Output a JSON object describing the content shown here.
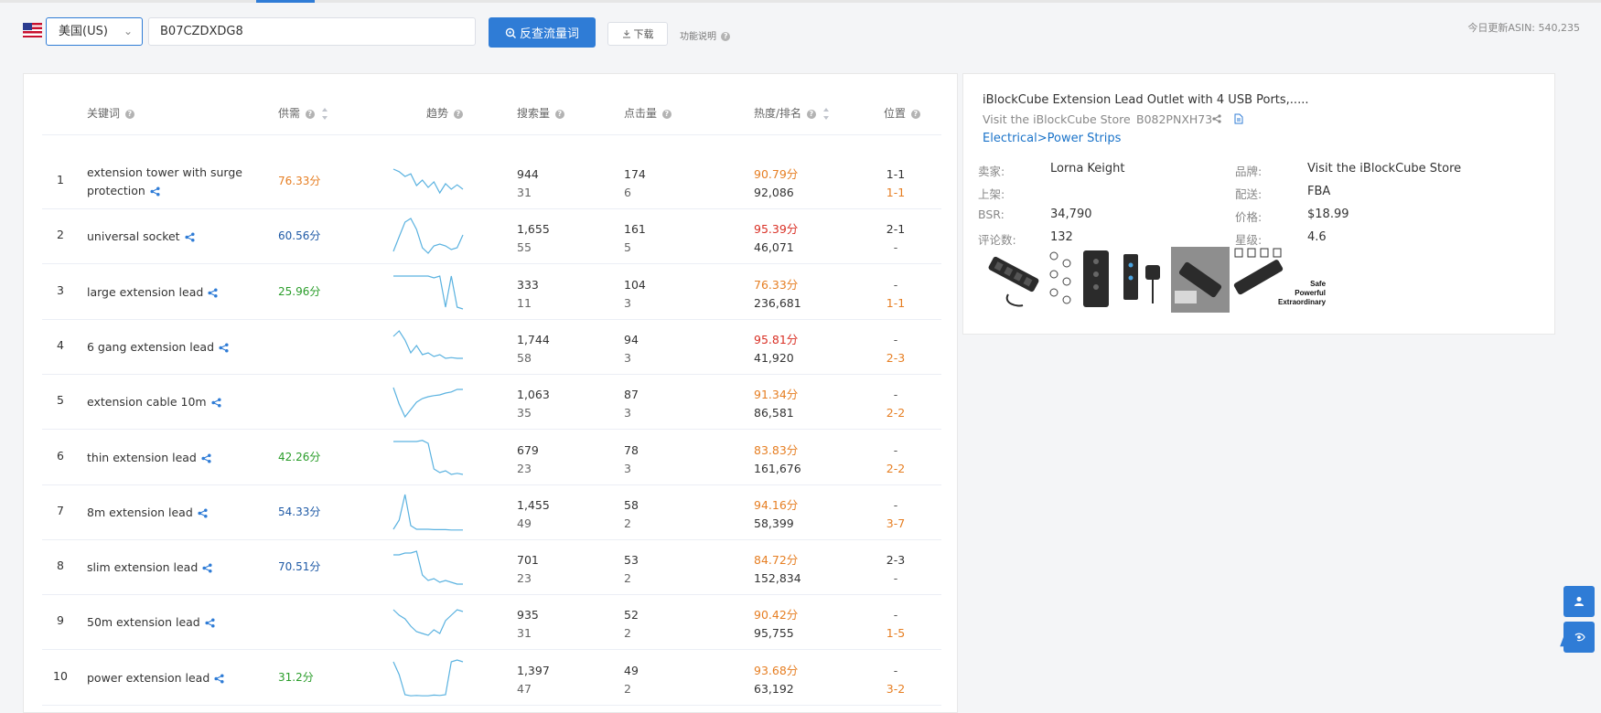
{
  "toolbar": {
    "marketplace": "美国(US)",
    "asin": "B07CZDXDG8",
    "reverse_button": "反查流量词",
    "download_button": "下载",
    "help_label": "功能说明",
    "update_info": "今日更新ASIN: 540,235"
  },
  "columns": {
    "keyword": "关键词",
    "supply": "供需",
    "trend": "趋势",
    "search_volume": "搜索量",
    "clicks": "点击量",
    "heat_rank": "热度/排名",
    "position": "位置"
  },
  "rows": [
    {
      "idx": "1",
      "keyword": "extension tower with surge protection",
      "supply": "76.33分",
      "supply_color": "#e67e22",
      "search": "944",
      "search_sub": "31",
      "clicks": "174",
      "clicks_sub": "6",
      "heat": "90.79分",
      "heat_color": "#e67e22",
      "rank": "92,086",
      "pos1": "1-1",
      "pos2": "1-1",
      "trend": [
        0.85,
        0.78,
        0.65,
        0.72,
        0.4,
        0.55,
        0.35,
        0.5,
        0.2,
        0.45,
        0.3,
        0.42,
        0.3
      ]
    },
    {
      "idx": "2",
      "keyword": "universal socket",
      "supply": "60.56分",
      "supply_color": "#1f5aa6",
      "search": "1,655",
      "search_sub": "55",
      "clicks": "161",
      "clicks_sub": "5",
      "heat": "95.39分",
      "heat_color": "#d93025",
      "rank": "46,071",
      "pos1": "2-1",
      "pos2": "-",
      "trend": [
        0.1,
        0.5,
        0.9,
        1.0,
        0.7,
        0.2,
        0.05,
        0.25,
        0.3,
        0.25,
        0.15,
        0.2,
        0.55
      ]
    },
    {
      "idx": "3",
      "keyword": "large extension lead",
      "supply": "25.96分",
      "supply_color": "#2a9d2a",
      "search": "333",
      "search_sub": "11",
      "clicks": "104",
      "clicks_sub": "3",
      "heat": "76.33分",
      "heat_color": "#e67e22",
      "rank": "236,681",
      "pos1": "-",
      "pos2": "1-1",
      "trend": [
        0.95,
        0.95,
        0.95,
        0.95,
        0.95,
        0.95,
        0.95,
        0.9,
        0.95,
        0.1,
        0.95,
        0.1,
        0.05
      ]
    },
    {
      "idx": "4",
      "keyword": "6 gang extension lead",
      "supply": "",
      "supply_color": "#333333",
      "search": "1,744",
      "search_sub": "58",
      "clicks": "94",
      "clicks_sub": "3",
      "heat": "95.81分",
      "heat_color": "#d93025",
      "rank": "41,920",
      "pos1": "-",
      "pos2": "2-3",
      "trend": [
        0.8,
        0.95,
        0.7,
        0.35,
        0.55,
        0.3,
        0.35,
        0.25,
        0.3,
        0.2,
        0.22,
        0.2,
        0.2
      ]
    },
    {
      "idx": "5",
      "keyword": "extension cable 10m",
      "supply": "",
      "supply_color": "#333333",
      "search": "1,063",
      "search_sub": "35",
      "clicks": "87",
      "clicks_sub": "3",
      "heat": "91.34分",
      "heat_color": "#e67e22",
      "rank": "86,581",
      "pos1": "-",
      "pos2": "2-2",
      "trend": [
        0.9,
        0.45,
        0.1,
        0.3,
        0.5,
        0.6,
        0.65,
        0.68,
        0.7,
        0.75,
        0.78,
        0.85,
        0.85
      ]
    },
    {
      "idx": "6",
      "keyword": "thin extension lead",
      "supply": "42.26分",
      "supply_color": "#2a9d2a",
      "search": "679",
      "search_sub": "23",
      "clicks": "78",
      "clicks_sub": "3",
      "heat": "83.83分",
      "heat_color": "#e67e22",
      "rank": "161,676",
      "pos1": "-",
      "pos2": "2-2",
      "trend": [
        0.95,
        0.95,
        0.95,
        0.95,
        0.95,
        0.98,
        0.9,
        0.2,
        0.1,
        0.15,
        0.05,
        0.08,
        0.05
      ]
    },
    {
      "idx": "7",
      "keyword": "8m extension lead",
      "supply": "54.33分",
      "supply_color": "#1f5aa6",
      "search": "1,455",
      "search_sub": "49",
      "clicks": "58",
      "clicks_sub": "2",
      "heat": "94.16分",
      "heat_color": "#e67e22",
      "rank": "58,399",
      "pos1": "-",
      "pos2": "3-7",
      "trend": [
        0.05,
        0.3,
        1.0,
        0.15,
        0.05,
        0.05,
        0.05,
        0.04,
        0.04,
        0.04,
        0.03,
        0.03,
        0.03
      ]
    },
    {
      "idx": "8",
      "keyword": "slim extension lead",
      "supply": "70.51分",
      "supply_color": "#1f5aa6",
      "search": "701",
      "search_sub": "23",
      "clicks": "53",
      "clicks_sub": "2",
      "heat": "84.72分",
      "heat_color": "#e67e22",
      "rank": "152,834",
      "pos1": "2-3",
      "pos2": "-",
      "trend": [
        0.85,
        0.85,
        0.9,
        0.9,
        0.95,
        0.3,
        0.15,
        0.2,
        0.1,
        0.15,
        0.1,
        0.05,
        0.05
      ]
    },
    {
      "idx": "9",
      "keyword": "50m extension lead",
      "supply": "",
      "supply_color": "#333333",
      "search": "935",
      "search_sub": "31",
      "clicks": "52",
      "clicks_sub": "2",
      "heat": "90.42分",
      "heat_color": "#e67e22",
      "rank": "95,755",
      "pos1": "-",
      "pos2": "1-5",
      "trend": [
        0.85,
        0.7,
        0.6,
        0.4,
        0.25,
        0.2,
        0.15,
        0.3,
        0.2,
        0.55,
        0.7,
        0.85,
        0.8
      ]
    },
    {
      "idx": "10",
      "keyword": "power extension lead",
      "supply": "31.2分",
      "supply_color": "#2a9d2a",
      "search": "1,397",
      "search_sub": "47",
      "clicks": "49",
      "clicks_sub": "2",
      "heat": "93.68分",
      "heat_color": "#e67e22",
      "rank": "63,192",
      "pos1": "-",
      "pos2": "3-2",
      "trend": [
        0.95,
        0.6,
        0.05,
        0.02,
        0.03,
        0.02,
        0.02,
        0.04,
        0.03,
        0.05,
        0.95,
        1.0,
        0.95
      ]
    }
  ],
  "product": {
    "title": "iBlockCube Extension Lead Outlet with 4 USB Ports,.....",
    "store": "Visit the iBlockCube Store",
    "asin": "B082PNXH73",
    "category": "Electrical>Power Strips",
    "seller_label": "卖家:",
    "seller": "Lorna Keight",
    "brand_label": "品牌:",
    "brand": "Visit the iBlockCube Store",
    "listed_label": "上架:",
    "listed": "",
    "shipping_label": "配送:",
    "shipping": "FBA",
    "bsr_label": "BSR:",
    "bsr": "34,790",
    "price_label": "价格:",
    "price": "$18.99",
    "reviews_label": "评论数:",
    "reviews": "132",
    "rating_label": "星级:",
    "rating": "4.6",
    "thumb_text": [
      "Safe",
      "Powerful",
      "Extraordinary"
    ]
  },
  "floating": {
    "letter": "A"
  },
  "colors": {
    "accent": "#2f7cd6",
    "trend_line": "#5ab2e0"
  }
}
